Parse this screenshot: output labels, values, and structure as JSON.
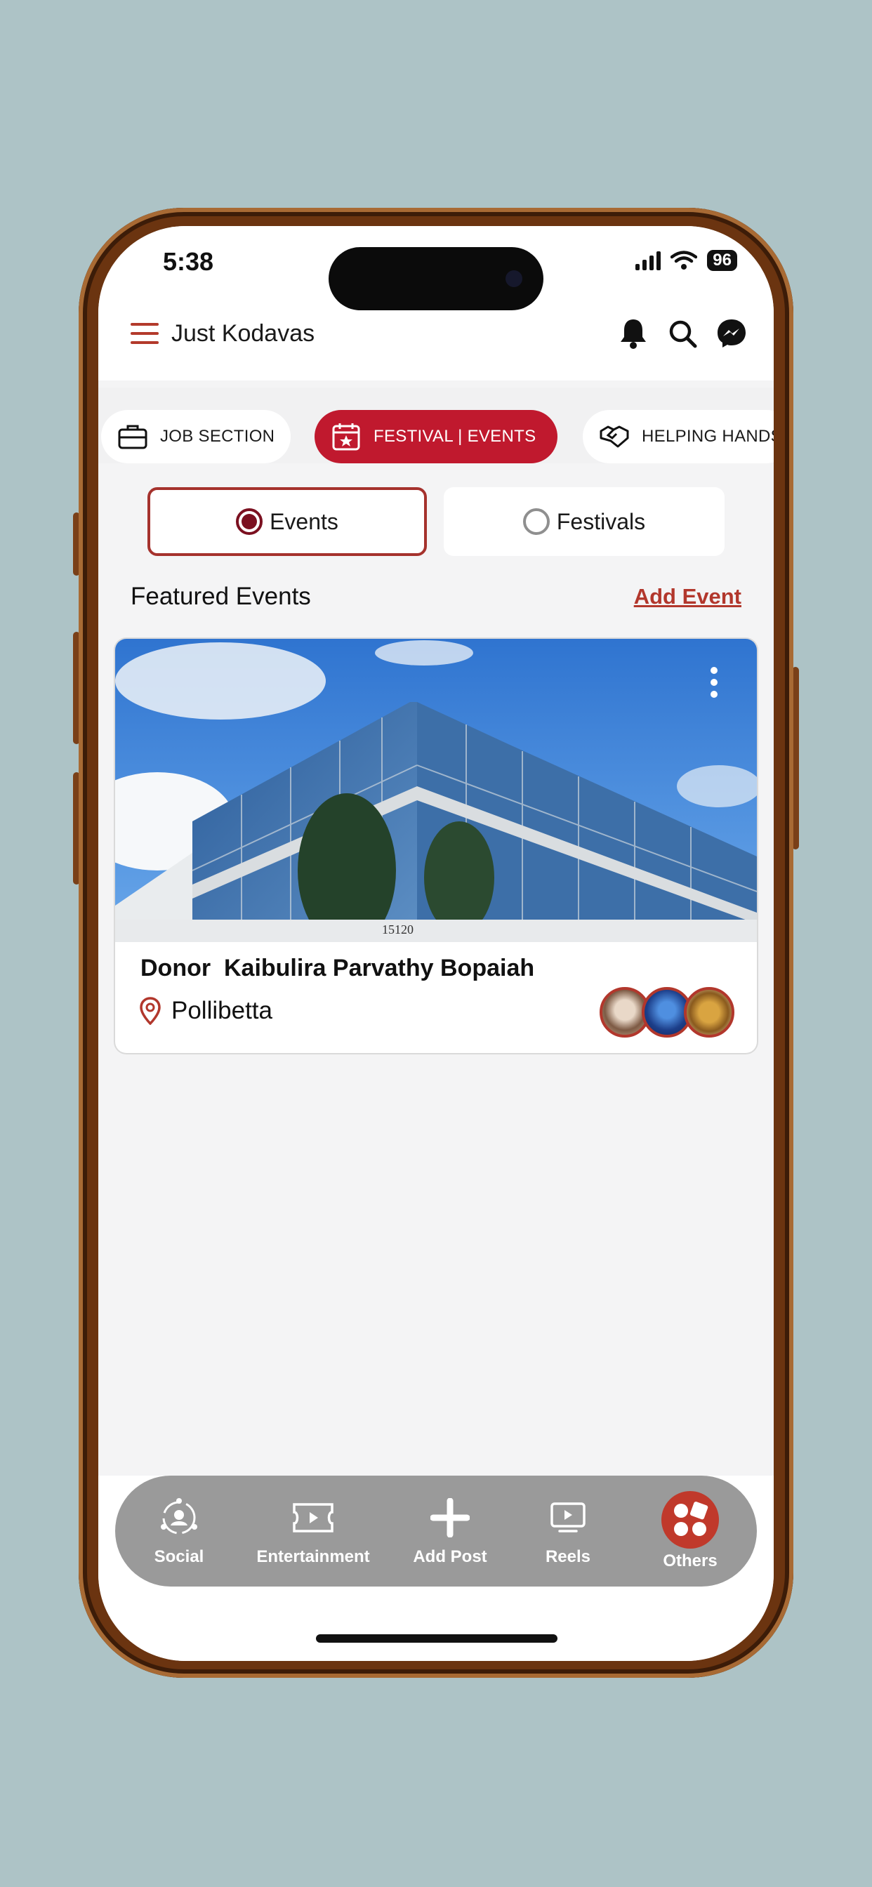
{
  "status_bar": {
    "time": "5:38",
    "battery": "96"
  },
  "header": {
    "title": "Just Kodavas"
  },
  "category_tabs": [
    {
      "label": "JOB SECTION",
      "icon": "briefcase-icon"
    },
    {
      "label": "FESTIVAL | EVENTS",
      "icon": "calendar-star-icon",
      "active": true
    },
    {
      "label": "HELPING HANDS",
      "icon": "handshake-icon"
    }
  ],
  "segment": {
    "events_label": "Events",
    "festivals_label": "Festivals",
    "selected": "Events"
  },
  "featured": {
    "title": "Featured Events",
    "add_label": "Add Event"
  },
  "event_card": {
    "title": "Donor  Kaibulira Parvathy Bopaiah",
    "location": "Pollibetta",
    "image_text": "15120"
  },
  "bottom_nav": [
    {
      "label": "Social",
      "icon": "people-circle-icon"
    },
    {
      "label": "Entertainment",
      "icon": "ticket-icon"
    },
    {
      "label": "Add Post",
      "icon": "plus-icon"
    },
    {
      "label": "Reels",
      "icon": "play-screen-icon"
    },
    {
      "label": "Others",
      "icon": "grid-shapes-icon"
    }
  ],
  "colors": {
    "accent": "#c0192e",
    "brand_red": "#b2372c",
    "background": "#adc3c6",
    "nav_bg": "#9a9a9a"
  }
}
